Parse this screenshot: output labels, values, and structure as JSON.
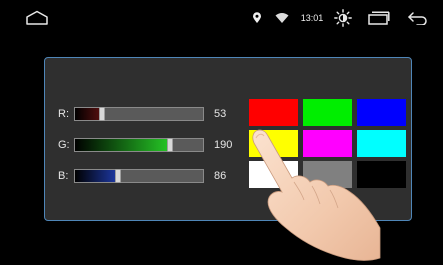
{
  "status_bar": {
    "time": "13:01",
    "icons": [
      "home-icon",
      "location-icon",
      "wifi-icon",
      "brightness-icon",
      "recent-apps-icon",
      "back-icon"
    ]
  },
  "sliders": {
    "r": {
      "label": "R:",
      "value": "53",
      "fraction": 0.208
    },
    "g": {
      "label": "G:",
      "value": "190",
      "fraction": 0.745
    },
    "b": {
      "label": "B:",
      "value": "86",
      "fraction": 0.337
    }
  },
  "swatches": [
    {
      "name": "red",
      "color": "#ff0000"
    },
    {
      "name": "green",
      "color": "#00ee00"
    },
    {
      "name": "blue",
      "color": "#0000ff"
    },
    {
      "name": "yellow",
      "color": "#ffff00"
    },
    {
      "name": "magenta",
      "color": "#ff00ff"
    },
    {
      "name": "cyan",
      "color": "#00ffff"
    },
    {
      "name": "white",
      "color": "#ffffff"
    },
    {
      "name": "gray",
      "color": "#808080"
    },
    {
      "name": "black",
      "color": "#000000"
    }
  ],
  "colors": {
    "panel_border": "#4f86b8",
    "panel_bg": "#2f2f2f",
    "background": "#000000"
  }
}
